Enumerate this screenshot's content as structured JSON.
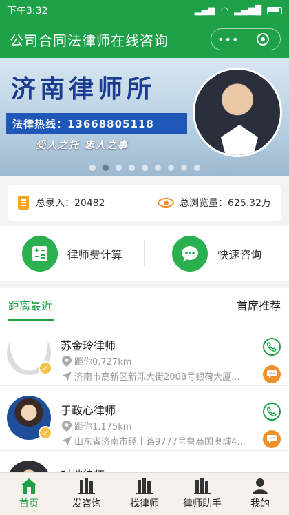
{
  "statusbar": {
    "time": "下午3:32"
  },
  "header": {
    "title": "公司合同法律师在线咨询",
    "capsule_dots": "•••"
  },
  "banner": {
    "firm_name": "济南律师所",
    "hotline": "法律热线：13668805118",
    "slogan": "受人之托 忠人之事",
    "page_count": 9,
    "active_index": 1
  },
  "stats": {
    "total_label": "总录入：20482",
    "views_label": "总浏览量：625.32万"
  },
  "actions": {
    "fee_calc": "律师费计算",
    "quick_consult": "快速咨询"
  },
  "tabs": {
    "nearest": "距离最近",
    "featured": "首席推荐"
  },
  "lawyers": [
    {
      "name": "苏金玲律师",
      "distance": "距你0.727km",
      "address": "济南市高新区新泺大街2008号银荷大厦..."
    },
    {
      "name": "于政心律师",
      "distance": "距你1.175km",
      "address": "山东省济南市经十路9777号鲁商国奥城4..."
    },
    {
      "name": "时楷律师",
      "distance": "",
      "address": ""
    }
  ],
  "nav": {
    "home": "首页",
    "ask": "发咨询",
    "find": "找律师",
    "helper": "律师助手",
    "mine": "我的"
  },
  "colors": {
    "primary": "#1fa14a",
    "accent": "#f0902a"
  }
}
